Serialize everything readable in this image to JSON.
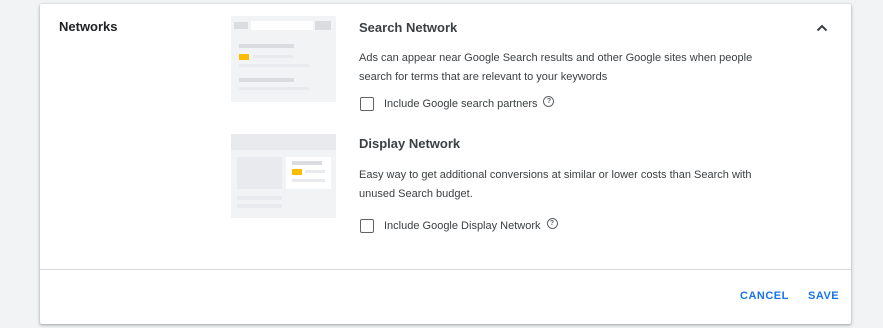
{
  "section": {
    "title": "Networks",
    "collapse_icon": "chevron-up-icon"
  },
  "search_network": {
    "title": "Search Network",
    "description": "Ads can appear near Google Search results and other Google sites when people search for terms that are relevant to your keywords",
    "checkbox_label": "Include Google search partners",
    "checked": false,
    "help_icon": "help-circle-icon"
  },
  "display_network": {
    "title": "Display Network",
    "description": "Easy way to get additional conversions at similar or lower costs than Search with unused Search budget.",
    "checkbox_label": "Include Google Display Network",
    "checked": false,
    "help_icon": "help-circle-icon"
  },
  "actions": {
    "cancel_label": "CANCEL",
    "save_label": "SAVE"
  },
  "colors": {
    "accent": "#1a73e8",
    "highlight": "#fbbc04",
    "background": "#f1f3f4"
  }
}
